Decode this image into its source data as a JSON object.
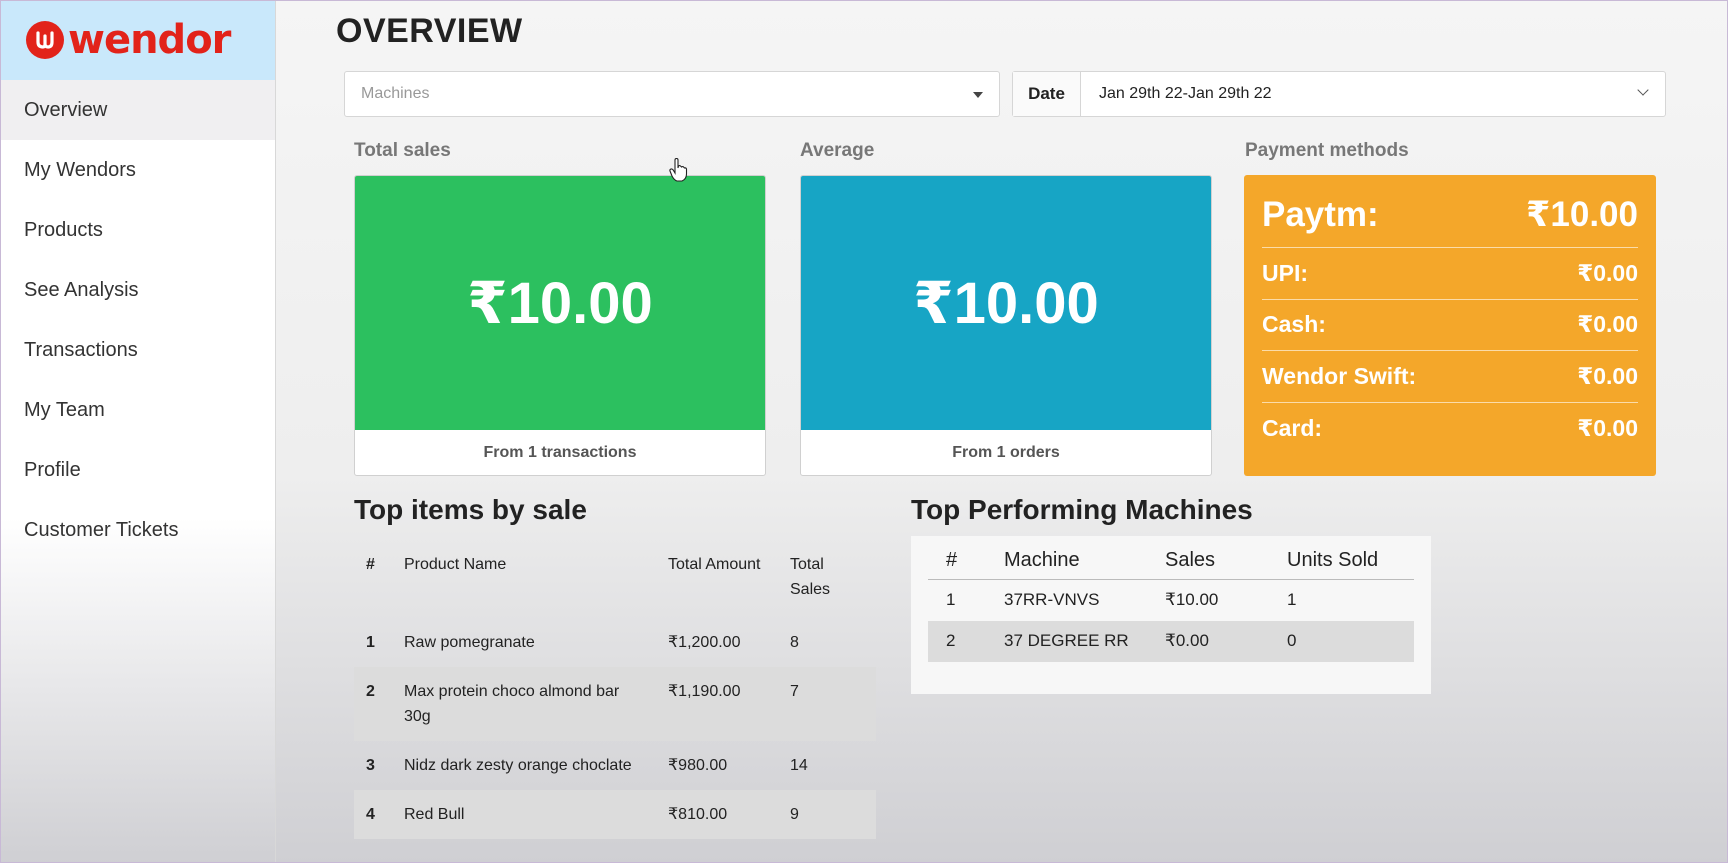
{
  "brand": {
    "name": "wendor"
  },
  "sidebar": {
    "items": [
      {
        "label": "Overview",
        "active": true
      },
      {
        "label": "My Wendors"
      },
      {
        "label": "Products"
      },
      {
        "label": "See Analysis"
      },
      {
        "label": "Transactions"
      },
      {
        "label": "My Team"
      },
      {
        "label": "Profile"
      },
      {
        "label": "Customer Tickets"
      }
    ]
  },
  "header": {
    "title": "OVERVIEW"
  },
  "filters": {
    "machines_placeholder": "Machines",
    "date_label": "Date",
    "date_value": "Jan 29th 22-Jan 29th 22"
  },
  "cards": {
    "total_sales": {
      "label": "Total sales",
      "value": "₹10.00",
      "footer": "From 1 transactions",
      "color": "#2cc05f"
    },
    "average": {
      "label": "Average",
      "value": "₹10.00",
      "footer": "From 1 orders",
      "color": "#17a5c5"
    },
    "payment_methods": {
      "label": "Payment methods",
      "color": "#f4a72a",
      "rows": [
        {
          "name": "Paytm:",
          "amount": "₹10.00"
        },
        {
          "name": "UPI:",
          "amount": "₹0.00"
        },
        {
          "name": "Cash:",
          "amount": "₹0.00"
        },
        {
          "name": "Wendor Swift:",
          "amount": "₹0.00"
        },
        {
          "name": "Card:",
          "amount": "₹0.00"
        }
      ]
    }
  },
  "top_items": {
    "title": "Top items by sale",
    "columns": [
      "#",
      "Product Name",
      "Total Amount",
      "Total Sales"
    ],
    "rows": [
      {
        "idx": "1",
        "name": "Raw pomegranate",
        "amount": "₹1,200.00",
        "sales": "8"
      },
      {
        "idx": "2",
        "name": "Max protein choco almond bar 30g",
        "amount": "₹1,190.00",
        "sales": "7"
      },
      {
        "idx": "3",
        "name": "Nidz dark zesty orange choclate",
        "amount": "₹980.00",
        "sales": "14"
      },
      {
        "idx": "4",
        "name": "Red Bull",
        "amount": "₹810.00",
        "sales": "9"
      }
    ]
  },
  "top_machines": {
    "title": "Top Performing Machines",
    "columns": [
      "#",
      "Machine",
      "Sales",
      "Units Sold"
    ],
    "rows": [
      {
        "idx": "1",
        "machine": "37RR-VNVS",
        "sales": "₹10.00",
        "units": "1"
      },
      {
        "idx": "2",
        "machine": "37 DEGREE RR",
        "sales": "₹0.00",
        "units": "0"
      }
    ]
  }
}
